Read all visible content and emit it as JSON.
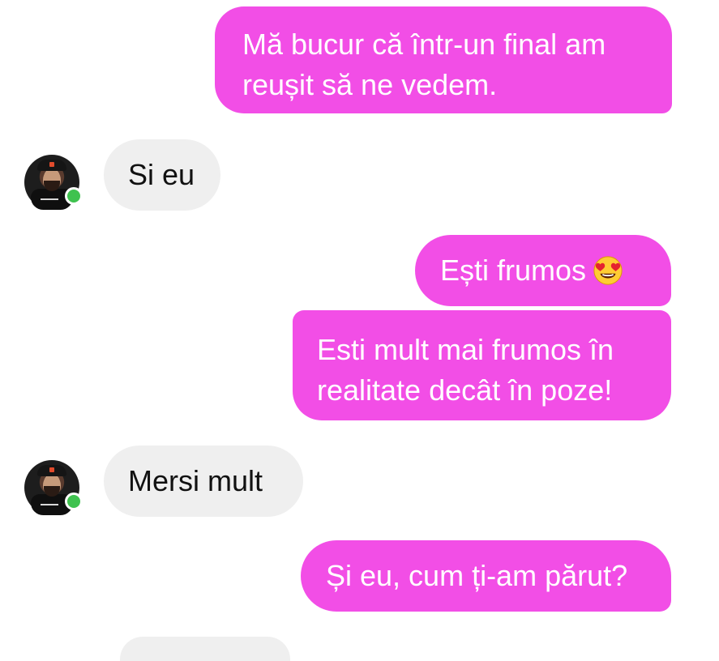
{
  "messages": [
    {
      "id": "m1",
      "direction": "sent",
      "text_lines": [
        "Mă bucur că într-un final am",
        "reușit să ne vedem."
      ]
    },
    {
      "id": "m2",
      "direction": "received",
      "text": "Si eu"
    },
    {
      "id": "m3",
      "direction": "sent",
      "text": "Ești frumos",
      "emoji": "heart-eyes-emoji"
    },
    {
      "id": "m4",
      "direction": "sent",
      "text_lines": [
        "Esti mult mai frumos în",
        "realitate decât în poze!"
      ]
    },
    {
      "id": "m5",
      "direction": "received",
      "text": "Mersi mult"
    },
    {
      "id": "m6",
      "direction": "sent",
      "text": "Și eu, cum ți-am părut?"
    }
  ],
  "contact": {
    "avatar": "profile-avatar",
    "online_status": "online"
  },
  "colors": {
    "sent_bubble": "#f24ee6",
    "received_bubble": "#efefef",
    "online": "#3fc24f"
  }
}
